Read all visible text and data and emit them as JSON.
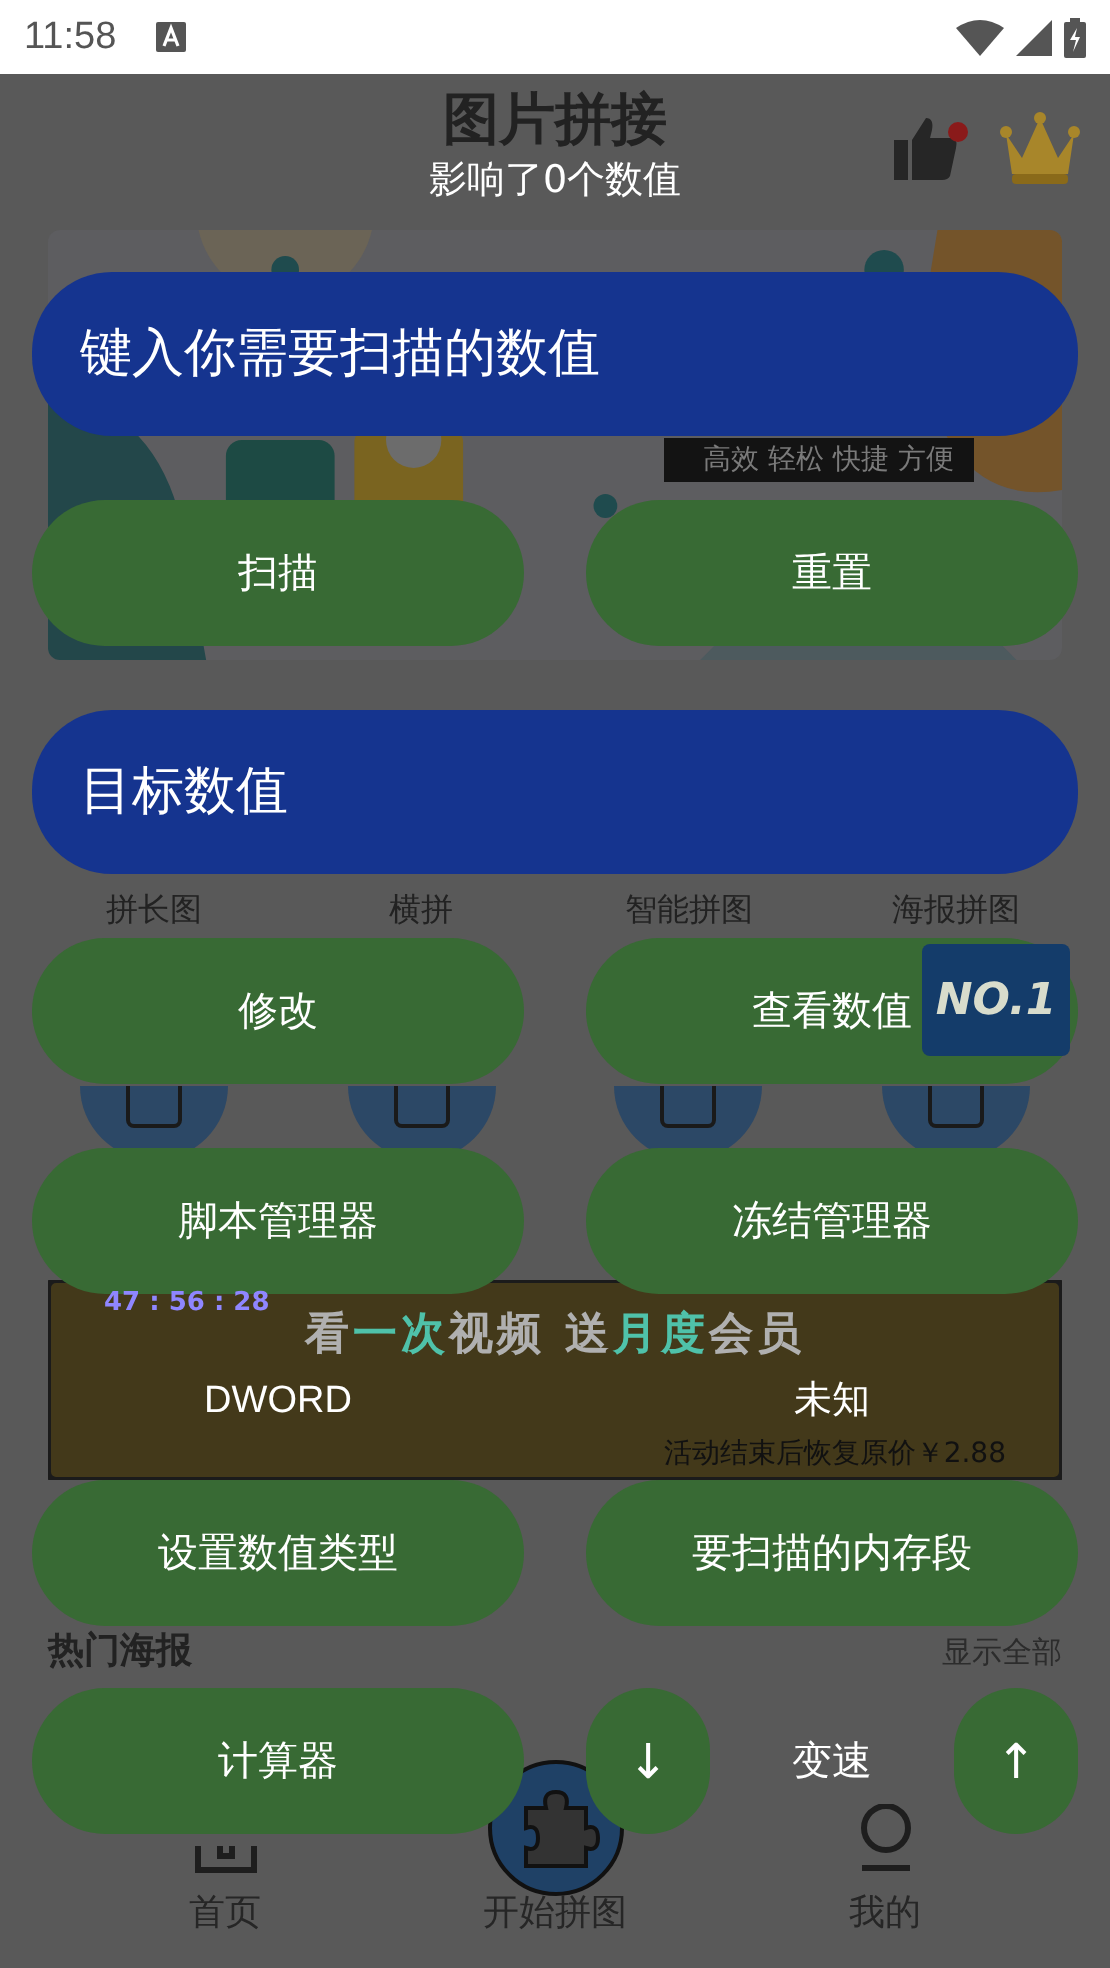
{
  "status_bar": {
    "time": "11:58"
  },
  "app": {
    "title": "图片拼接",
    "hero_tagline": "高效 轻松 快捷 方便",
    "features": [
      {
        "label": "拼长图"
      },
      {
        "label": "横拼"
      },
      {
        "label": "智能拼图"
      },
      {
        "label": "海报拼图"
      }
    ],
    "promo": {
      "countdown": "47 : 56 : 28",
      "headline": [
        {
          "text": "看",
          "highlight": false
        },
        {
          "text": "一次",
          "highlight": true
        },
        {
          "text": "视频 送",
          "highlight": false
        },
        {
          "text": "月度",
          "highlight": true
        },
        {
          "text": "会员",
          "highlight": false
        }
      ],
      "note": "活动结束后恢复原价￥2.88"
    },
    "section_title": "热门海报",
    "section_link": "显示全部",
    "nav": [
      {
        "label": "首页",
        "kind": "home"
      },
      {
        "label": "开始拼图",
        "kind": "puzzle"
      },
      {
        "label": "我的",
        "kind": "profile"
      }
    ]
  },
  "panel": {
    "message": "影响了0个数值",
    "scan_field": {
      "placeholder": "键入你需要扫描的数值"
    },
    "scan_buttons": [
      "扫描",
      "重置"
    ],
    "target_field": {
      "placeholder": "目标数值"
    },
    "action_rows": [
      [
        "修改",
        "查看数值"
      ],
      [
        "脚本管理器",
        "冻结管理器"
      ]
    ],
    "value_type": "DWORD",
    "memory_region": "未知",
    "setting_buttons": [
      "设置数值类型",
      "要扫描的内存段"
    ],
    "calculator_button": "计算器",
    "down_button": "↓",
    "speed_label": "变速",
    "up_button": "↑",
    "badge": "NO.1"
  }
}
